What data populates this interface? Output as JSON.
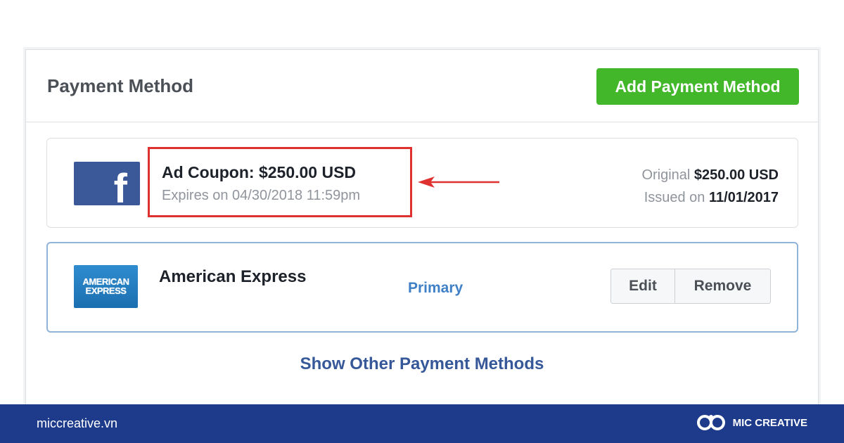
{
  "panel": {
    "title": "Payment Method",
    "add_button_label": "Add Payment Method"
  },
  "coupon": {
    "logo_letter": "f",
    "title": "Ad Coupon: $250.00 USD",
    "expires": "Expires on 04/30/2018 11:59pm",
    "original_label": "Original",
    "original_value": "$250.00 USD",
    "issued_label": "Issued on",
    "issued_value": "11/01/2017",
    "highlight_color": "#e03131"
  },
  "amex": {
    "logo_line1": "AMERICAN",
    "logo_line2": "EXPRESS",
    "name": "American Express",
    "status": "Primary",
    "edit_label": "Edit",
    "remove_label": "Remove"
  },
  "show_other_label": "Show Other Payment Methods",
  "footer": {
    "site": "miccreative.vn",
    "brand": "MIC CREATIVE"
  },
  "colors": {
    "add_button": "#42b72a",
    "link": "#365899",
    "primary": "#4080c6",
    "facebook": "#3b5998",
    "footer": "#1d3b8a"
  }
}
